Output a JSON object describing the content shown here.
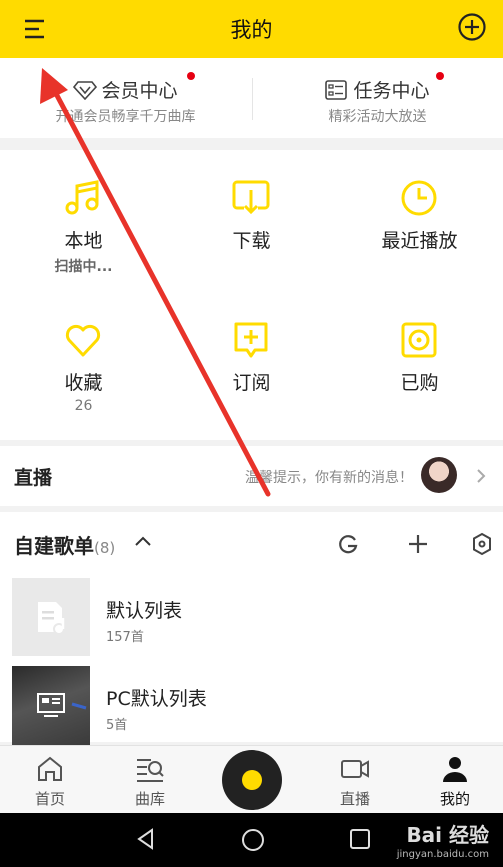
{
  "header": {
    "title": "我的",
    "menu_icon": "menu-icon",
    "add_icon": "plus-circle-icon"
  },
  "vip": {
    "left": {
      "title": "会员中心",
      "subtitle": "开通会员畅享千万曲库"
    },
    "right": {
      "title": "任务中心",
      "subtitle": "精彩活动大放送"
    },
    "dot_color": "#e60012"
  },
  "grid": {
    "local": {
      "label": "本地",
      "sub": "扫描中..."
    },
    "download": {
      "label": "下载"
    },
    "recent": {
      "label": "最近播放"
    },
    "favorite": {
      "label": "收藏",
      "sub": "26"
    },
    "subscribe": {
      "label": "订阅"
    },
    "purchased": {
      "label": "已购"
    },
    "icon_color": "#ffdb00"
  },
  "live": {
    "title": "直播",
    "tip": "温馨提示，你有新的消息！"
  },
  "playlists": {
    "title": "自建歌单",
    "count": "(8)",
    "items": [
      {
        "name": "默认列表",
        "count": "157首"
      },
      {
        "name": "PC默认列表",
        "count": "5首"
      }
    ]
  },
  "nav": {
    "items": [
      {
        "label": "首页"
      },
      {
        "label": "曲库"
      },
      {
        "label": "直播"
      },
      {
        "label": "我的"
      }
    ]
  },
  "watermark": {
    "brand": "Bai 经验",
    "url": "jingyan.baidu.com"
  },
  "accent": "#ffdb00"
}
